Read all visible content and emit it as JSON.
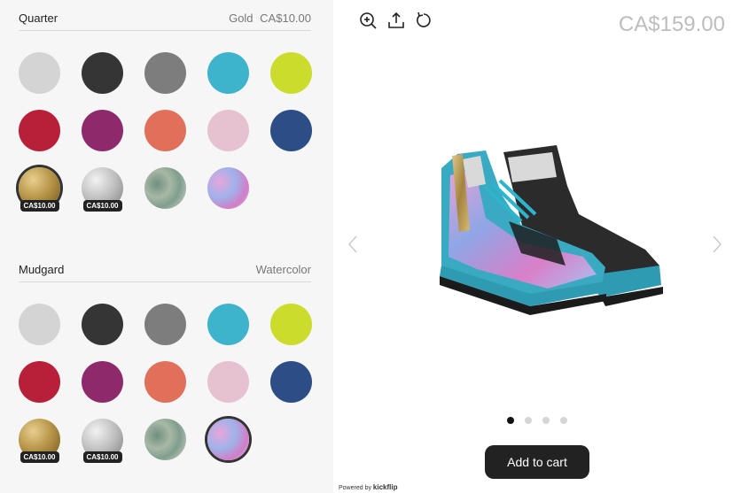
{
  "sections": [
    {
      "title": "Quarter",
      "selected_name": "Gold",
      "selected_price": "CA$10.00",
      "swatches": [
        {
          "color": "#d4d4d4",
          "price": ""
        },
        {
          "color": "#353535",
          "price": ""
        },
        {
          "color": "#7d7d7d",
          "price": ""
        },
        {
          "color": "#3db3cc",
          "price": ""
        },
        {
          "color": "#cbdc2c",
          "price": ""
        },
        {
          "color": "#b8203a",
          "price": ""
        },
        {
          "color": "#8e2a6c",
          "price": ""
        },
        {
          "color": "#e0705a",
          "price": ""
        },
        {
          "color": "#e6c2d1",
          "price": ""
        },
        {
          "color": "#2c4d85",
          "price": ""
        },
        {
          "color": "gold-texture",
          "price": "CA$10.00",
          "selected": true
        },
        {
          "color": "silver-texture",
          "price": "CA$10.00"
        },
        {
          "color": "camo-texture",
          "price": ""
        },
        {
          "color": "watercolor-texture",
          "price": ""
        }
      ]
    },
    {
      "title": "Mudgard",
      "selected_name": "Watercolor",
      "selected_price": "",
      "swatches": [
        {
          "color": "#d4d4d4",
          "price": ""
        },
        {
          "color": "#353535",
          "price": ""
        },
        {
          "color": "#7d7d7d",
          "price": ""
        },
        {
          "color": "#3db3cc",
          "price": ""
        },
        {
          "color": "#cbdc2c",
          "price": ""
        },
        {
          "color": "#b8203a",
          "price": ""
        },
        {
          "color": "#8e2a6c",
          "price": ""
        },
        {
          "color": "#e0705a",
          "price": ""
        },
        {
          "color": "#e6c2d1",
          "price": ""
        },
        {
          "color": "#2c4d85",
          "price": ""
        },
        {
          "color": "gold-texture",
          "price": "CA$10.00"
        },
        {
          "color": "silver-texture",
          "price": "CA$10.00"
        },
        {
          "color": "camo-texture",
          "price": ""
        },
        {
          "color": "watercolor-texture",
          "price": "",
          "selected": true
        }
      ]
    }
  ],
  "toolbar": {
    "icons": [
      "zoom-in-icon",
      "share-icon",
      "reset-icon"
    ]
  },
  "total_price": "CA$159.00",
  "gallery": {
    "dot_count": 4,
    "active_index": 0
  },
  "add_to_cart_label": "Add to cart",
  "powered_by": {
    "prefix": "Powered by",
    "brand": "kickflip"
  }
}
